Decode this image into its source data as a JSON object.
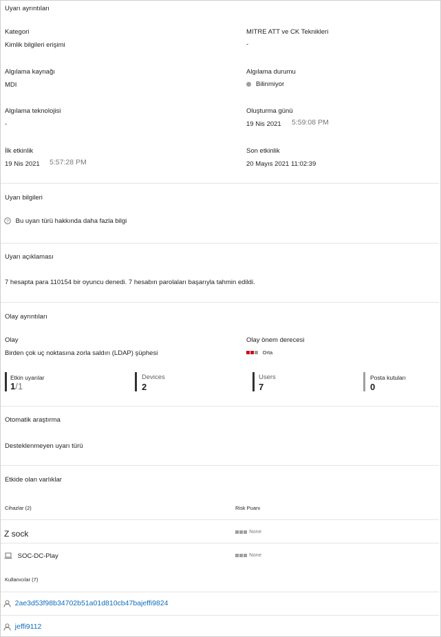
{
  "alert_details": {
    "title": "Uyarı ayrıntıları",
    "category_label": "Kategori",
    "category_value": "Kimlik bilgileri erişimi",
    "mitre_label": "MITRE ATT ve CK Teknikleri",
    "mitre_value": "-",
    "source_label": "Algılama kaynağı",
    "source_value": "MDI",
    "status_label": "Algılama durumu",
    "status_value": "Bilinmiyor",
    "tech_label": "Algılama teknolojisi",
    "tech_value": "-",
    "created_label": "Oluşturma günü",
    "created_date": "19 Nis 2021",
    "created_time": "5:59:08 PM",
    "first_label": "İlk etkinlik",
    "first_date": "19 Nis 2021",
    "first_time": "5:57:28 PM",
    "last_label": "Son etkinlik",
    "last_value": "20 Mayıs 2021 11:02:39"
  },
  "alert_info": {
    "title": "Uyarı bilgileri",
    "link_text": "Bu uyarı türü hakkında daha fazla bilgi"
  },
  "alert_description": {
    "title": "Uyarı açıklaması",
    "text": "7 hesapta para 110154 bir oyuncu denedi. 7 hesabın parolaları başarıyla tahmin edildi."
  },
  "incident_details": {
    "title": "Olay ayrıntıları",
    "incident_label": "Olay",
    "incident_value": "Birden çok uç noktasına zorla saldırı (LDAP) şüphesi",
    "severity_label": "Olay önem derecesi",
    "severity_value": "Orta",
    "colors": {
      "sev_on": "#c50f1f",
      "sev_off": "#a19f9d"
    },
    "stats": [
      {
        "label": "Etkin uyarılar",
        "value": "1",
        "denominator": "/1"
      },
      {
        "label": "Devices",
        "value": "2"
      },
      {
        "label": "Users",
        "value": "7"
      },
      {
        "label": "Posta kutuları",
        "value": "0"
      }
    ]
  },
  "auto_investigation": {
    "title": "Otomatik araştırma",
    "value": "Desteklenmeyen uyarı türü"
  },
  "affected_entities": {
    "title": "Etkide olan varlıklar",
    "devices_header": "Cihazlar (2)",
    "risk_header": "Risk Puanı",
    "devices": [
      {
        "name": "Z sock",
        "risk": "None"
      },
      {
        "name": "SOC-DC-Play",
        "risk": "None",
        "icon": "laptop-icon"
      }
    ],
    "users_header": "Kullanıcılar (7)",
    "users": [
      {
        "name": "2ae3d53f98b34702b51a01d810cb47bajeffi9824",
        "icon": "person-icon"
      },
      {
        "name": "jeffi9112",
        "icon": "person-icon"
      }
    ]
  }
}
